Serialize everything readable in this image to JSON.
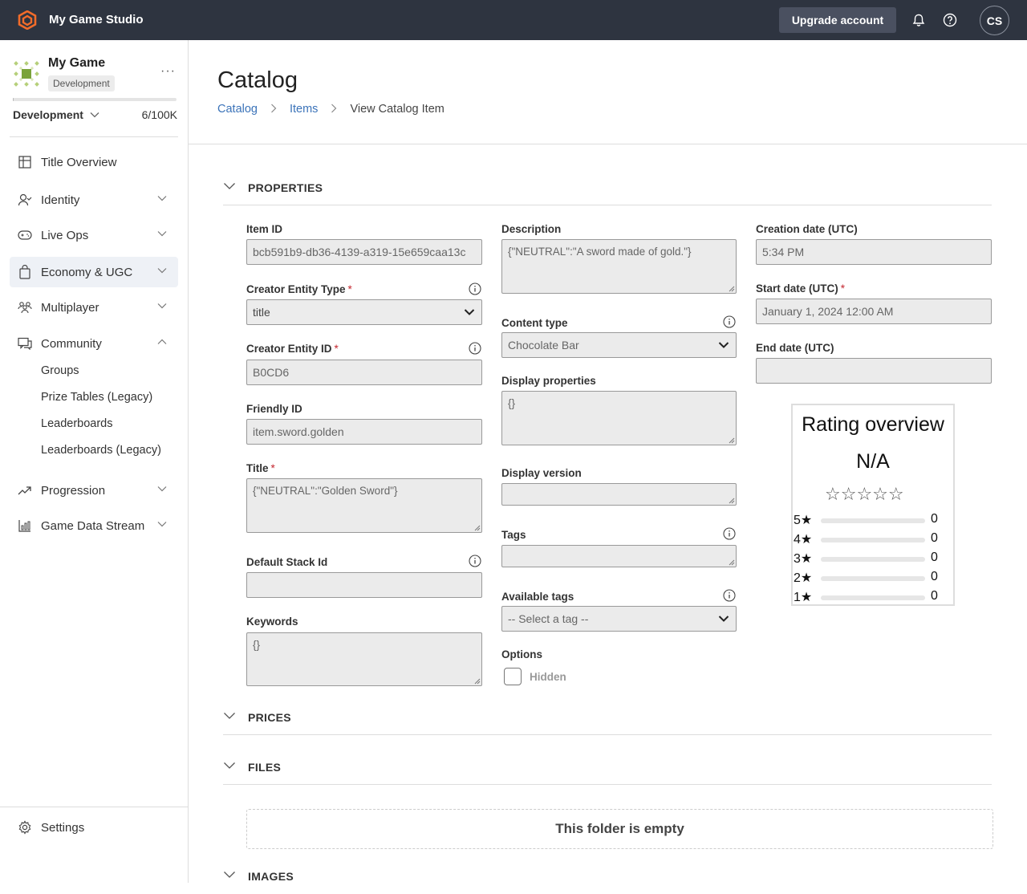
{
  "topbar": {
    "studio_name": "My Game Studio",
    "upgrade_label": "Upgrade account",
    "avatar_initials": "CS"
  },
  "sidebar": {
    "game_name": "My Game",
    "env_badge": "Development",
    "env_selector": "Development",
    "usage_count": "6/100K",
    "usage_fraction": 0.0001,
    "nav": [
      {
        "label": "Title Overview",
        "icon": "grid-icon"
      },
      {
        "label": "Identity",
        "icon": "person-icon"
      },
      {
        "label": "Live Ops",
        "icon": "gamepad-icon"
      },
      {
        "label": "Economy & UGC",
        "icon": "shopping-bag-icon"
      },
      {
        "label": "Multiplayer",
        "icon": "people-icon"
      },
      {
        "label": "Community",
        "icon": "chat-icon"
      },
      {
        "label": "Progression",
        "icon": "trend-up-icon"
      },
      {
        "label": "Game Data Stream",
        "icon": "bar-chart-icon"
      }
    ],
    "community_sub": [
      "Groups",
      "Prize Tables (Legacy)",
      "Leaderboards",
      "Leaderboards (Legacy)"
    ],
    "settings_label": "Settings"
  },
  "page": {
    "title": "Catalog",
    "breadcrumb": [
      "Catalog",
      "Items",
      "View Catalog Item"
    ]
  },
  "sections": {
    "properties": "PROPERTIES",
    "prices": "PRICES",
    "files": "FILES",
    "images": "IMAGES"
  },
  "fields": {
    "item_id": {
      "label": "Item ID",
      "value": "bcb591b9-db36-4139-a319-15e659caa13c"
    },
    "creator_entity_type": {
      "label": "Creator Entity Type",
      "value": "title"
    },
    "creator_entity_id": {
      "label": "Creator Entity ID",
      "value": "B0CD6"
    },
    "friendly_id": {
      "label": "Friendly ID",
      "value": "item.sword.golden"
    },
    "title": {
      "label": "Title",
      "value": "{\"NEUTRAL\":\"Golden Sword\"}"
    },
    "default_stack_id": {
      "label": "Default Stack Id",
      "value": ""
    },
    "keywords": {
      "label": "Keywords",
      "value": "{}"
    },
    "description": {
      "label": "Description",
      "value": "{\"NEUTRAL\":\"A sword made of gold.\"}"
    },
    "content_type": {
      "label": "Content type",
      "value": "Chocolate Bar"
    },
    "display_properties": {
      "label": "Display properties",
      "value": "{}"
    },
    "display_version": {
      "label": "Display version",
      "value": ""
    },
    "tags": {
      "label": "Tags",
      "value": ""
    },
    "available_tags": {
      "label": "Available tags",
      "value": "-- Select a tag --"
    },
    "options": {
      "label": "Options",
      "hidden_label": "Hidden",
      "hidden_checked": false
    },
    "creation_date": {
      "label": "Creation date (UTC)",
      "value": "5:34 PM"
    },
    "start_date": {
      "label": "Start date (UTC)",
      "value": "January 1, 2024 12:00 AM"
    },
    "end_date": {
      "label": "End date (UTC)",
      "value": ""
    }
  },
  "rating": {
    "title": "Rating overview",
    "average": "N/A",
    "empty_stars": "☆☆☆☆☆",
    "rows": [
      {
        "label": "5★",
        "count": "0",
        "fraction": 0
      },
      {
        "label": "4★",
        "count": "0",
        "fraction": 0
      },
      {
        "label": "3★",
        "count": "0",
        "fraction": 0
      },
      {
        "label": "2★",
        "count": "0",
        "fraction": 0
      },
      {
        "label": "1★",
        "count": "0",
        "fraction": 0
      }
    ]
  },
  "files": {
    "empty_text": "This folder is empty"
  }
}
